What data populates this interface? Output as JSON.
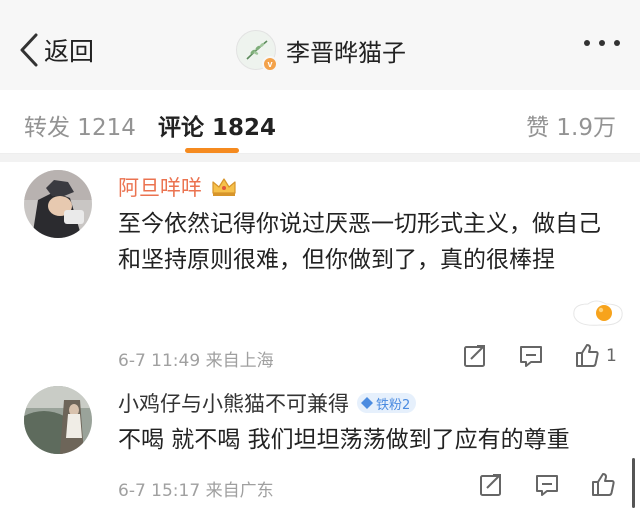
{
  "header": {
    "back_label": "返回",
    "title": "李晋晔猫子",
    "verified_badge": "v"
  },
  "tabs": {
    "repost": "转发 1214",
    "comment": "评论 1824",
    "like": "赞 1.9万",
    "accent_color": "#f58a1f"
  },
  "comments": [
    {
      "username": "阿旦咩咩",
      "username_color": "#eb7350",
      "badge_icon": "crown-icon",
      "text": "至今依然记得你说过厌恶一切形式主义，做自己和坚持原则很难，但你做到了，真的很棒捏",
      "meta": "6-7 11:49  来自上海",
      "like_count": "1"
    },
    {
      "username": "小鸡仔与小熊猫不可兼得",
      "username_color": "#333333",
      "fan_badge": "铁粉2",
      "text": "不喝 就不喝 我们坦坦荡荡做到了应有的尊重",
      "meta": "6-7 15:17  来自广东"
    }
  ]
}
